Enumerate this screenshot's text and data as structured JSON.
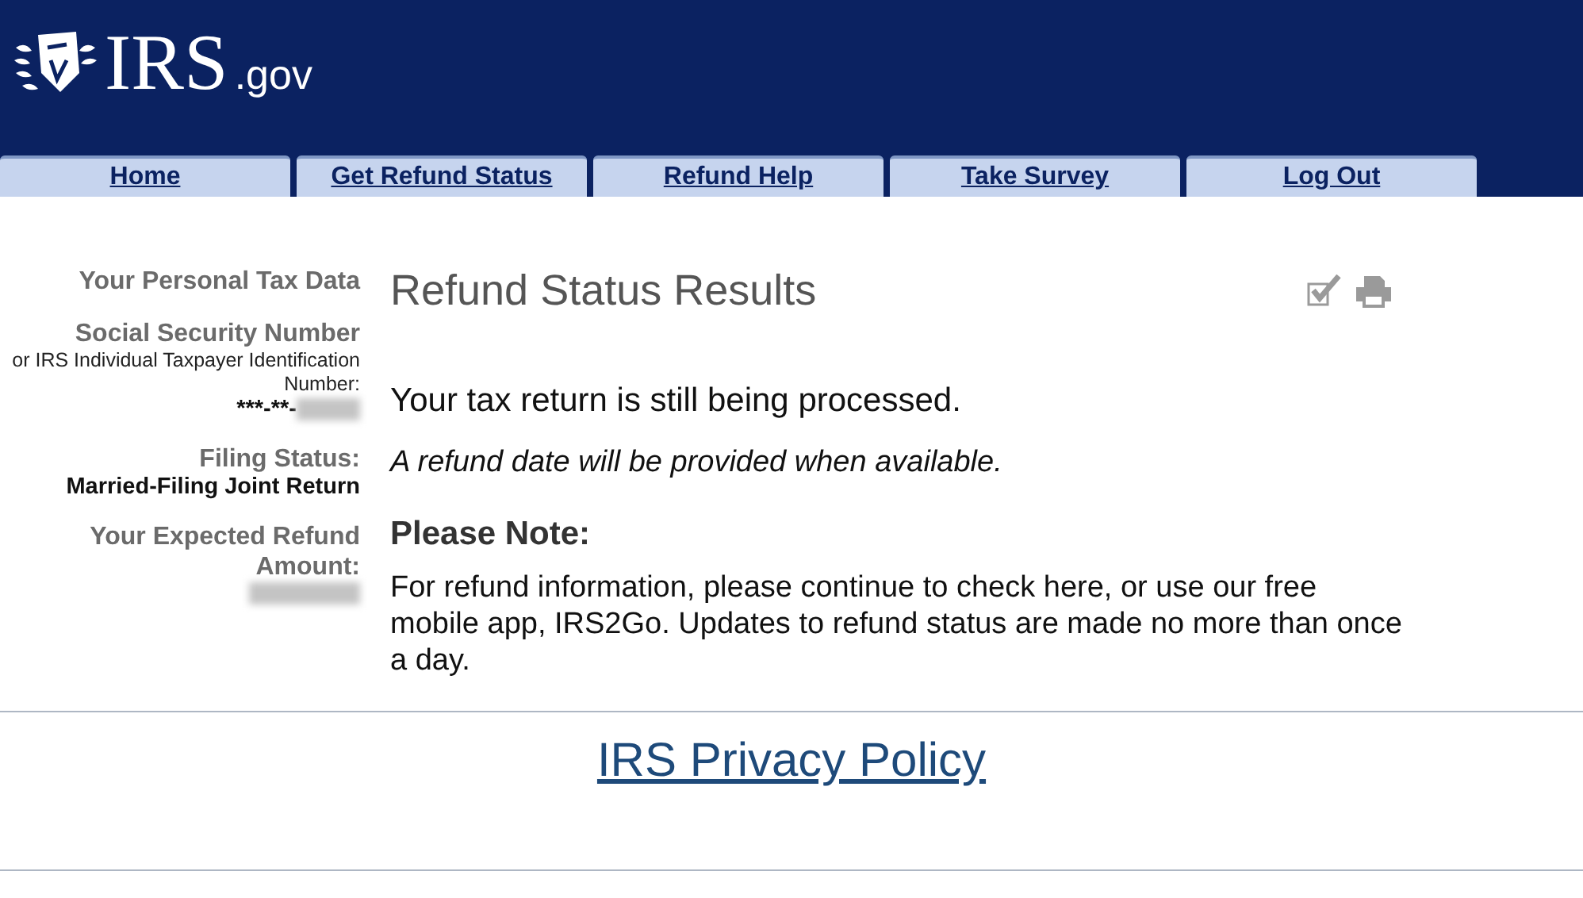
{
  "header": {
    "logo_text": "IRS",
    "logo_suffix": ".gov"
  },
  "nav": [
    {
      "label": "Home"
    },
    {
      "label": "Get Refund Status"
    },
    {
      "label": "Refund Help"
    },
    {
      "label": "Take Survey"
    },
    {
      "label": "Log Out"
    }
  ],
  "sidebar": {
    "title": "Your Personal Tax Data",
    "ssn_label": "Social Security Number",
    "ssn_sublabel": "or IRS Individual Taxpayer Identification Number:",
    "ssn_value": "***-**-",
    "filing_label": "Filing Status:",
    "filing_value": "Married-Filing Joint Return",
    "refund_label": "Your Expected Refund Amount:"
  },
  "main": {
    "title": "Refund Status Results",
    "status": "Your tax return is still being processed.",
    "note_italic": "A refund date will be provided when available.",
    "note_heading": "Please Note:",
    "note_text": "For refund information, please continue to check here, or use our free mobile app, IRS2Go. Updates to refund status are made no more than once a day."
  },
  "footer": {
    "link": "IRS Privacy Policy"
  }
}
